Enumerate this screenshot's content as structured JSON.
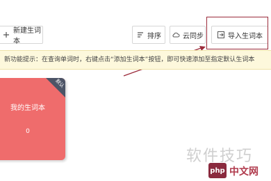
{
  "toolbar": {
    "new_label": "新建生词本",
    "sort_label": "排序",
    "sync_label": "云同步",
    "import_label": "导入生词本"
  },
  "tip": {
    "text": "新功能提示：在查询单词时，右键点击“添加生词本”按钮，即可快速添加至指定默认生词本"
  },
  "wordbook": {
    "title": "我的生词本",
    "count": "0",
    "badge": "默认"
  },
  "watermark": {
    "text": "软件技巧",
    "logo": "php",
    "site": "中文网"
  },
  "colors": {
    "card": "#ef6c6c",
    "badge": "#4c5466",
    "tip_bg": "#fdf8dc",
    "highlight": "#9b2b3a"
  }
}
